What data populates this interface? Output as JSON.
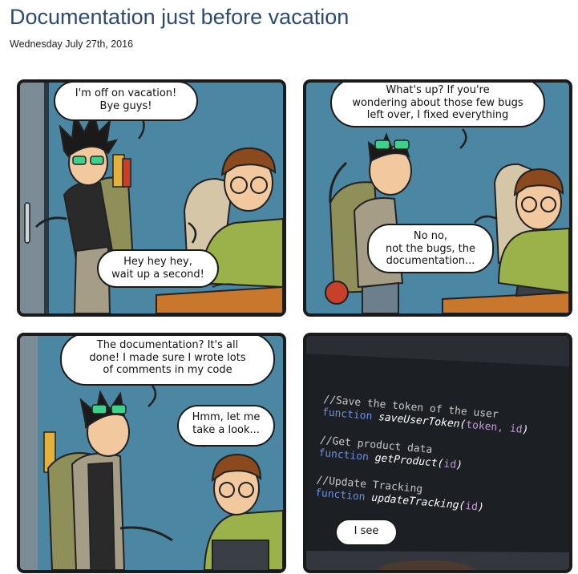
{
  "header": {
    "title": "Documentation just before vacation",
    "date": "Wednesday July 27th, 2016"
  },
  "panels": [
    {
      "bubbles": [
        [
          "I'm off on vacation!",
          "Bye guys!"
        ],
        [
          "Hey hey hey,",
          "wait up a second!"
        ]
      ]
    },
    {
      "bubbles": [
        [
          "What's up? If you're",
          "wondering about those few bugs",
          "left over, I fixed everything"
        ],
        [
          "No no,",
          "not the bugs, the",
          "documentation..."
        ]
      ]
    },
    {
      "bubbles": [
        [
          "The documentation? It's all",
          "done! I made sure I wrote lots",
          "of comments in my code"
        ],
        [
          "Hmm, let me",
          "take a look..."
        ]
      ]
    },
    {
      "code": [
        {
          "comment": "//Save the token of the user",
          "keyword": "function",
          "name": "saveUserToken(",
          "args": "token, id",
          "close": ")"
        },
        {
          "comment": "//Get product data",
          "keyword": "function",
          "name": "getProduct(",
          "args": "id",
          "close": ")"
        },
        {
          "comment": "//Update Tracking",
          "keyword": "function",
          "name": "updateTracking(",
          "args": "id",
          "close": ")"
        }
      ],
      "bubbles": [
        [
          "I see"
        ]
      ]
    }
  ],
  "colors": {
    "title": "#2e4a6e",
    "wall": "#4b86a3",
    "screen": "#1c1f24",
    "keyword": "#6e8fe0",
    "argument": "#c59ad8"
  }
}
